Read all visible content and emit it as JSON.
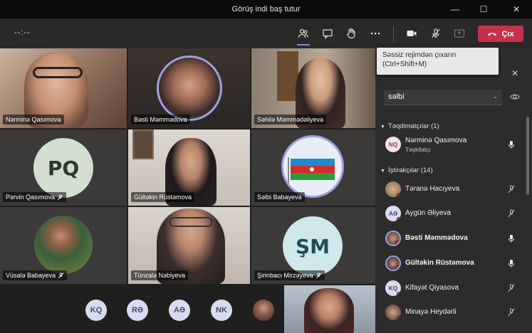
{
  "window": {
    "title": "Görüş indi baş tutur",
    "minimize": "—",
    "maximize": "☐",
    "close": "✕"
  },
  "toolbar": {
    "timer": "--:--",
    "leave_label": "Çıx"
  },
  "tooltip": {
    "line1": "Səssiz rejimdən çıxarın",
    "line2": "(Ctrl+Shift+M)"
  },
  "tiles": [
    {
      "name": "Nərminə Qasımova",
      "muted": false
    },
    {
      "name": "Bəsti Məmmədova",
      "muted": false
    },
    {
      "name": "Səhilə Məmmədəliyeva",
      "muted": false
    },
    {
      "name": "Pərvin Qasımova",
      "muted": true,
      "initials": "PQ"
    },
    {
      "name": "Gültəkin Rüstəmova",
      "muted": false
    },
    {
      "name": "Səlbi Babayeva",
      "muted": false
    },
    {
      "name": "Vüsalə Babayeva",
      "muted": true
    },
    {
      "name": "Tünzalə Nəbiyeva",
      "muted": false
    },
    {
      "name": "Şirinbacı Mirzəyeva",
      "muted": true,
      "initials": "ŞM"
    }
  ],
  "strip": {
    "avatars": [
      "KQ",
      "RƏ",
      "AƏ",
      "NK"
    ]
  },
  "panel": {
    "search_value": "səlbi",
    "presenters_header": "Təqdimatçılar (1)",
    "attendees_header": "İştirakçılar (14)",
    "presenter": {
      "name": "Nərminə Qasımova",
      "initials": "NQ",
      "role": "Təşkilatçı"
    },
    "attendees": [
      {
        "name": "Təranə Hacıyeva",
        "initials": "",
        "photo": true,
        "bold": false,
        "mic": "muted"
      },
      {
        "name": "Aygün Əliyeva",
        "initials": "AƏ",
        "photo": false,
        "bold": false,
        "mic": "muted"
      },
      {
        "name": "Bəsti Məmmədova",
        "initials": "",
        "photo": true,
        "bold": true,
        "mic": "on"
      },
      {
        "name": "Gültəkin Rüstəmova",
        "initials": "",
        "photo": true,
        "bold": true,
        "mic": "on"
      },
      {
        "name": "Kifayət Qiyasova",
        "initials": "KQ",
        "photo": false,
        "bold": false,
        "mic": "muted"
      },
      {
        "name": "Minayə Heydərli",
        "initials": "",
        "photo": true,
        "bold": false,
        "mic": "muted"
      }
    ]
  },
  "colors": {
    "accent": "#8b8cc7",
    "leave": "#c4314b",
    "avatar_bg": "#d9dcf0",
    "avatar_fg": "#464775"
  }
}
